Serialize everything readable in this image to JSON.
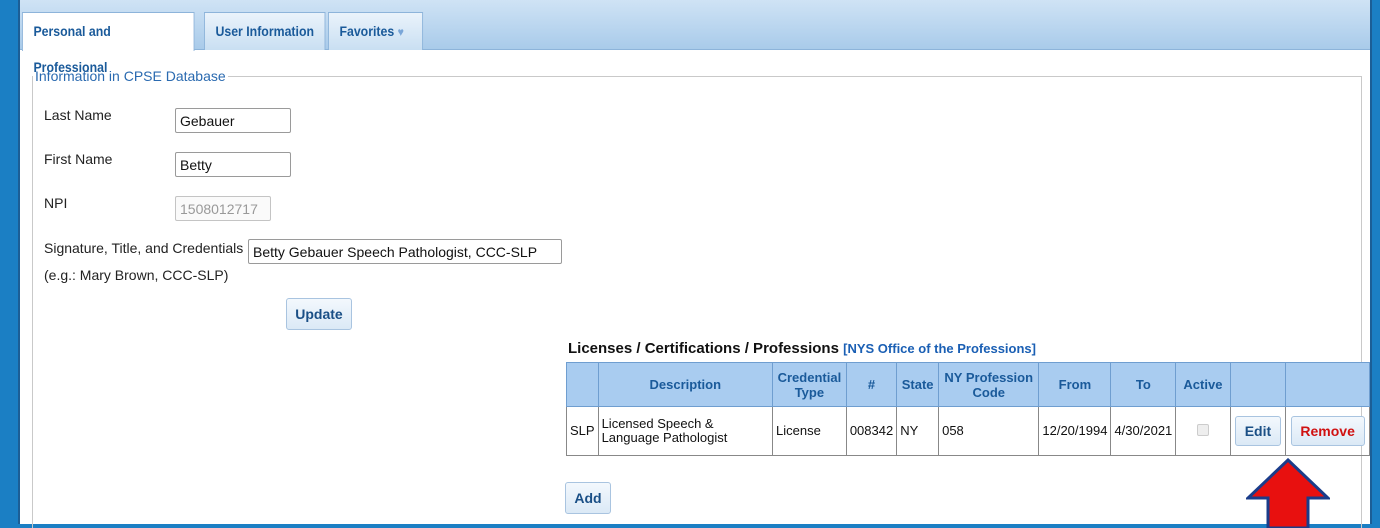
{
  "tabs": [
    {
      "label": "Personal and Professional"
    },
    {
      "label": "User Information"
    },
    {
      "label": "Favorites",
      "icon": "heart-icon"
    }
  ],
  "section": {
    "legend": "Information in CPSE Database"
  },
  "fields": {
    "last_name": {
      "label": "Last Name",
      "value": "Gebauer"
    },
    "first_name": {
      "label": "First Name",
      "value": "Betty"
    },
    "npi": {
      "label": "NPI",
      "value": "1508012717"
    },
    "signature": {
      "label": "Signature, Title, and Credentials",
      "hint": "(e.g.: Mary Brown, CCC-SLP)",
      "value": "Betty Gebauer Speech Pathologist, CCC-SLP"
    }
  },
  "update_label": "Update",
  "licenses": {
    "title": "Licenses / Certifications / Professions",
    "link_open": "[",
    "link_text": "NYS Office of the Professions",
    "link_close": "]",
    "headers": [
      "",
      "Description",
      "Credential Type",
      "#",
      "State",
      "NY Profession Code",
      "From",
      "To",
      "Active",
      "",
      ""
    ],
    "rows": [
      {
        "code": "SLP",
        "description": "Licensed Speech & Language Pathologist",
        "credential_type": "License",
        "number": "008342",
        "state": "NY",
        "profession_code": "058",
        "from": "12/20/1994",
        "to": "4/30/2021",
        "active": false,
        "edit_label": "Edit",
        "remove_label": "Remove"
      }
    ],
    "add_label": "Add"
  },
  "colors": {
    "accent": "#1a5a9a",
    "header_bg": "#a9ccf0",
    "arrow": "#e8100f",
    "remove": "#d01111"
  }
}
